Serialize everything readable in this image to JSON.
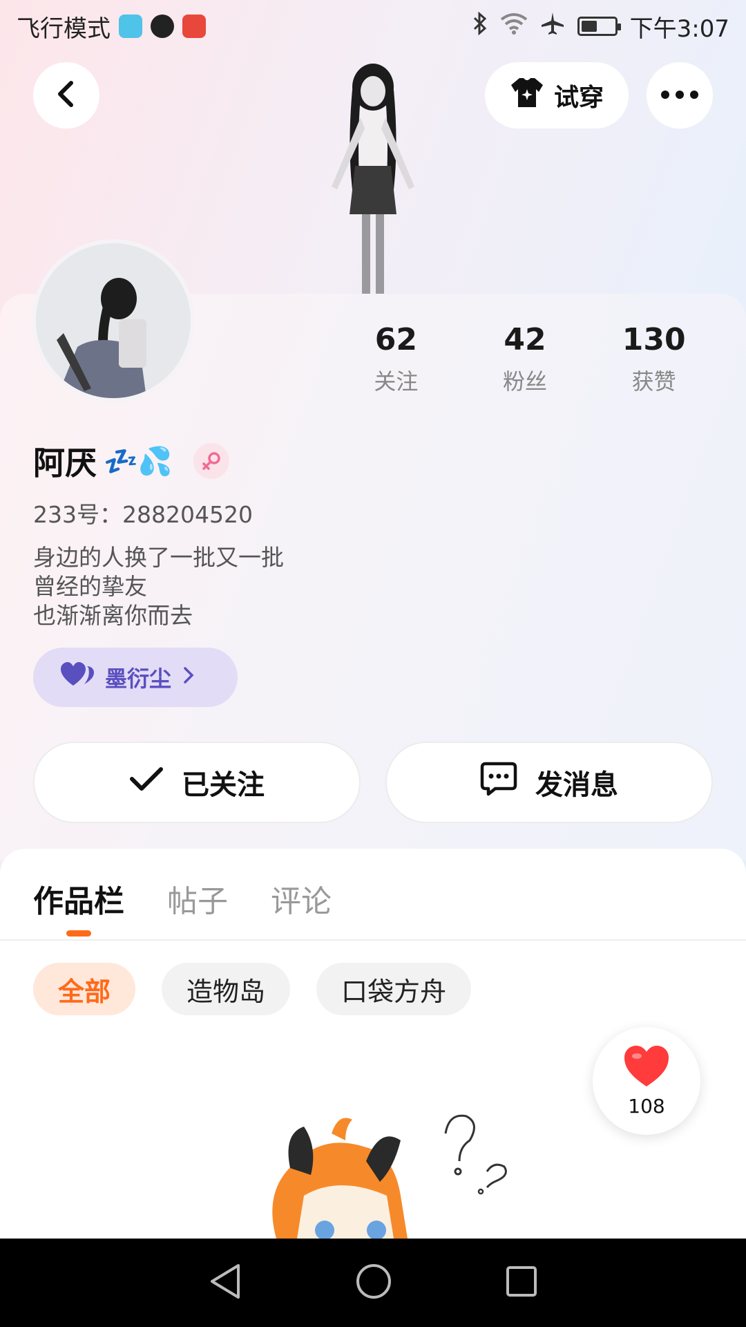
{
  "status_bar": {
    "carrier_text": "飞行模式",
    "time": "下午3:07"
  },
  "header": {
    "try_on_label": "试穿"
  },
  "profile": {
    "username": "阿厌",
    "username_emoji": "💤💦",
    "gender": "female",
    "uid_text": "233号：288204520",
    "bio_lines": [
      "身边的人换了一批又一批",
      "曾经的挚友",
      "也渐渐离你而去"
    ],
    "tag_label": "墨衍尘",
    "stats": [
      {
        "value": "62",
        "label": "关注"
      },
      {
        "value": "42",
        "label": "粉丝"
      },
      {
        "value": "130",
        "label": "获赞"
      }
    ]
  },
  "actions": {
    "follow_label": "已关注",
    "message_label": "发消息"
  },
  "tabs": [
    {
      "label": "作品栏",
      "active": true
    },
    {
      "label": "帖子",
      "active": false
    },
    {
      "label": "评论",
      "active": false
    }
  ],
  "filters": [
    {
      "label": "全部",
      "active": true
    },
    {
      "label": "造物岛",
      "active": false
    },
    {
      "label": "口袋方舟",
      "active": false
    }
  ],
  "like_float": {
    "count": "108"
  },
  "colors": {
    "accent": "#ff6a1a",
    "tag_bg": "#e2dcf6",
    "tag_text": "#5a4fbf",
    "heart": "#ff3b3b"
  }
}
